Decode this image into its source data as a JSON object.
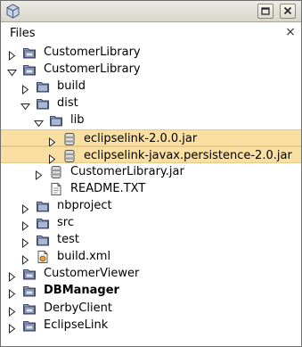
{
  "window": {
    "title": ""
  },
  "panel": {
    "title": "Files",
    "close_glyph": "×"
  },
  "tree": [
    {
      "label": "CustomerLibrary",
      "depth": 0,
      "toggle": "collapsed",
      "icon": "project-folder-icon"
    },
    {
      "label": "CustomerLibrary",
      "depth": 0,
      "toggle": "expanded",
      "icon": "project-folder-icon"
    },
    {
      "label": "build",
      "depth": 1,
      "toggle": "collapsed",
      "icon": "folder-icon"
    },
    {
      "label": "dist",
      "depth": 1,
      "toggle": "expanded",
      "icon": "folder-icon"
    },
    {
      "label": "lib",
      "depth": 2,
      "toggle": "expanded",
      "icon": "folder-icon"
    },
    {
      "label": "eclipselink-2.0.0.jar",
      "depth": 3,
      "toggle": "collapsed",
      "icon": "jar-icon",
      "selected": true
    },
    {
      "label": "eclipselink-javax.persistence-2.0.jar",
      "depth": 3,
      "toggle": "collapsed",
      "icon": "jar-icon",
      "selected": true
    },
    {
      "label": "CustomerLibrary.jar",
      "depth": 2,
      "toggle": "collapsed",
      "icon": "jar-icon"
    },
    {
      "label": "README.TXT",
      "depth": 2,
      "toggle": "none",
      "icon": "text-file-icon"
    },
    {
      "label": "nbproject",
      "depth": 1,
      "toggle": "collapsed",
      "icon": "folder-icon"
    },
    {
      "label": "src",
      "depth": 1,
      "toggle": "collapsed",
      "icon": "folder-icon"
    },
    {
      "label": "test",
      "depth": 1,
      "toggle": "collapsed",
      "icon": "folder-icon"
    },
    {
      "label": "build.xml",
      "depth": 1,
      "toggle": "collapsed",
      "icon": "xml-file-icon"
    },
    {
      "label": "CustomerViewer",
      "depth": 0,
      "toggle": "collapsed",
      "icon": "project-folder-icon"
    },
    {
      "label": "DBManager",
      "depth": 0,
      "toggle": "collapsed",
      "icon": "project-folder-icon",
      "bold": true
    },
    {
      "label": "DerbyClient",
      "depth": 0,
      "toggle": "collapsed",
      "icon": "project-folder-icon"
    },
    {
      "label": "EclipseLink",
      "depth": 0,
      "toggle": "collapsed",
      "icon": "project-folder-icon"
    }
  ],
  "colors": {
    "selection": "#f9dfa1",
    "folder": "#6f7fa6",
    "jar": "#8f8f8f"
  }
}
